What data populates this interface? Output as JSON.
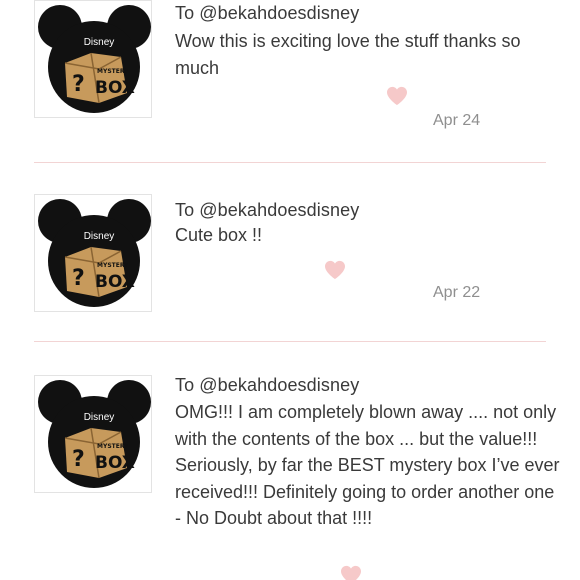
{
  "reviews": [
    {
      "to": "To @bekahdoesdisney",
      "text": "Wow this is exciting love the stuff thanks so much",
      "date": "Apr 24",
      "thumb": {
        "disney_label": "Disney",
        "box_label": "BOX",
        "mystery_label": "MYSTERY",
        "question": "?"
      }
    },
    {
      "to": "To @bekahdoesdisney",
      "text": "Cute box !!",
      "date": "Apr 22",
      "thumb": {
        "disney_label": "Disney",
        "box_label": "BOX",
        "mystery_label": "MYSTERY",
        "question": "?"
      }
    },
    {
      "to": "To @bekahdoesdisney",
      "text": "OMG!!! I am completely blown away .... not only with the contents of the box ... but the value!!! Seriously, by far the BEST mystery box I’ve ever received!!! Definitely going to order another one - No Doubt about that !!!!",
      "date": "",
      "thumb": {
        "disney_label": "Disney",
        "box_label": "BOX",
        "mystery_label": "MYSTERY",
        "question": "?"
      }
    }
  ],
  "colors": {
    "divider": "#f2d4d4",
    "heart": "#f6c9c9",
    "text": "#3a3a3a",
    "date": "#8f8f8f"
  },
  "icons": {
    "heart": "heart-icon",
    "thumbnail": "mickey-mystery-box-icon"
  }
}
